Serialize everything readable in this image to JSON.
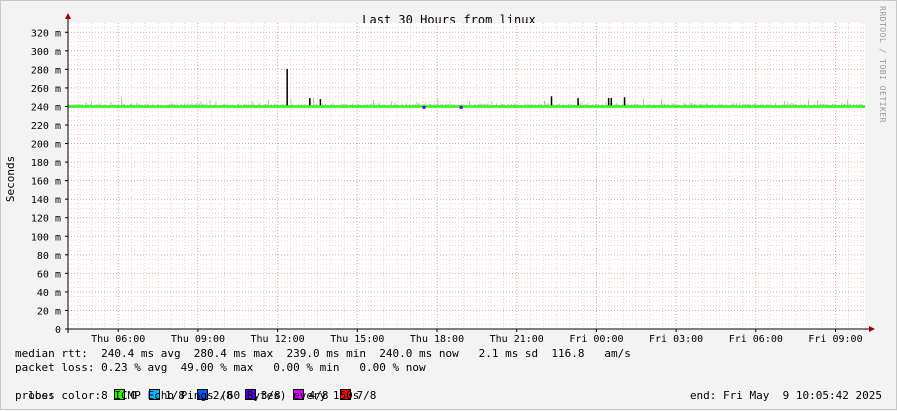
{
  "chart_data": {
    "type": "line",
    "title": "Last 30 Hours from linux",
    "ylabel": "Seconds",
    "xlabel": "",
    "ylim": [
      0,
      330
    ],
    "y_ticks": [
      "0",
      "20 m",
      "40 m",
      "60 m",
      "80 m",
      "100 m",
      "120 m",
      "140 m",
      "160 m",
      "180 m",
      "200 m",
      "220 m",
      "240 m",
      "260 m",
      "280 m",
      "300 m",
      "320 m"
    ],
    "x_range_hours": [
      0,
      30
    ],
    "x_ticks": [
      {
        "label": "Thu 06:00",
        "hour": 1.89
      },
      {
        "label": "Thu 09:00",
        "hour": 4.89
      },
      {
        "label": "Thu 12:00",
        "hour": 7.89
      },
      {
        "label": "Thu 15:00",
        "hour": 10.89
      },
      {
        "label": "Thu 18:00",
        "hour": 13.89
      },
      {
        "label": "Thu 21:00",
        "hour": 16.89
      },
      {
        "label": "Fri 00:00",
        "hour": 19.89
      },
      {
        "label": "Fri 03:00",
        "hour": 22.89
      },
      {
        "label": "Fri 06:00",
        "hour": 25.89
      },
      {
        "label": "Fri 09:00",
        "hour": 28.89
      }
    ],
    "grid": true,
    "median_ms_baseline": 240.0,
    "series": [
      {
        "name": "median rtt",
        "color": "#000000",
        "spikes": [
          {
            "hour": 8.25,
            "ms": 280.4
          },
          {
            "hour": 9.1,
            "ms": 249
          },
          {
            "hour": 9.5,
            "ms": 248
          },
          {
            "hour": 18.2,
            "ms": 251
          },
          {
            "hour": 19.2,
            "ms": 249
          },
          {
            "hour": 20.35,
            "ms": 249
          },
          {
            "hour": 20.45,
            "ms": 249
          },
          {
            "hour": 20.95,
            "ms": 250
          }
        ]
      },
      {
        "name": "loss 0",
        "color": "#26ff00",
        "baseline_ms": 240.0
      }
    ],
    "smoke_color": "#bdbdbd",
    "loss_markers": [
      {
        "hour": 13.4,
        "ms": 239,
        "color": "#5e00ff"
      },
      {
        "hour": 14.8,
        "ms": 239,
        "color": "#5e00ff"
      }
    ]
  },
  "legend": {
    "median_line": "median rtt:  240.4 ms avg  280.4 ms max  239.0 ms min  240.0 ms now   2.1 ms sd  116.8   am/s",
    "packet_loss_line": "packet loss: 0.23 % avg  49.00 % max   0.00 % min   0.00 % now",
    "loss_color_label": "loss color:",
    "loss_colors": [
      {
        "label": "0",
        "color": "#26ff00"
      },
      {
        "label": "1/8",
        "color": "#00b8ff"
      },
      {
        "label": "2/8",
        "color": "#0059ff"
      },
      {
        "label": "3/8",
        "color": "#5e00ff"
      },
      {
        "label": "4/8",
        "color": "#dd00ff"
      },
      {
        "label": "7/8",
        "color": "#ff0000"
      }
    ],
    "probe_line": "probe:       8 ICMP Echo Pings (60 Bytes) every 150s",
    "end_line": "end: Fri May  9 10:05:42 2025"
  },
  "watermark": "RRDTOOL / TOBI OETIKER"
}
